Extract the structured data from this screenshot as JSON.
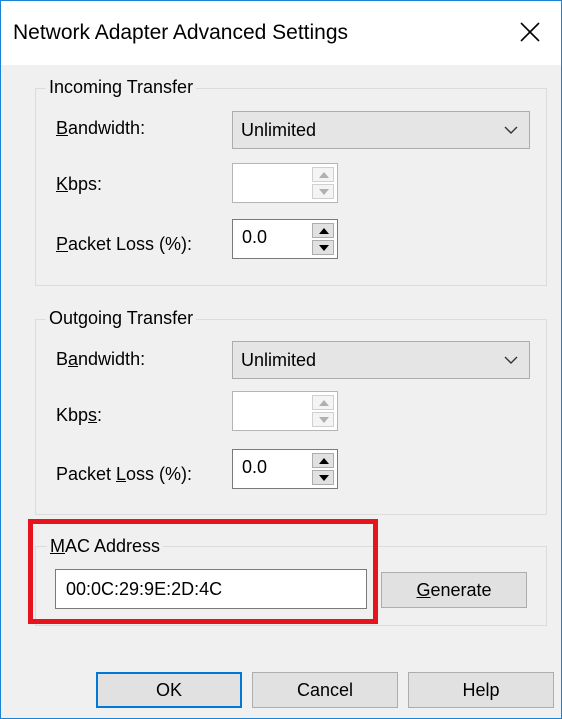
{
  "window": {
    "title": "Network Adapter Advanced Settings",
    "close_icon": "close-icon"
  },
  "incoming": {
    "legend": "Incoming Transfer",
    "bandwidth_label_pre": "",
    "bandwidth_label_mn": "B",
    "bandwidth_label_post": "andwidth:",
    "bandwidth_value": "Unlimited",
    "kbps_label_pre": "",
    "kbps_label_mn": "K",
    "kbps_label_post": "bps:",
    "kbps_value": "",
    "loss_label_pre": "",
    "loss_label_mn": "P",
    "loss_label_post": "acket Loss (%):",
    "loss_value": "0.0"
  },
  "outgoing": {
    "legend": "Outgoing Transfer",
    "bandwidth_label_pre": "B",
    "bandwidth_label_mn": "a",
    "bandwidth_label_post": "ndwidth:",
    "bandwidth_value": "Unlimited",
    "kbps_label_pre": "Kbp",
    "kbps_label_mn": "s",
    "kbps_label_post": ":",
    "kbps_value": "",
    "loss_label_pre": "Packet ",
    "loss_label_mn": "L",
    "loss_label_post": "oss (%):",
    "loss_value": "0.0"
  },
  "mac": {
    "legend_pre": "",
    "legend_mn": "M",
    "legend_post": "AC Address",
    "value": "00:0C:29:9E:2D:4C",
    "generate_pre": "",
    "generate_mn": "G",
    "generate_post": "enerate"
  },
  "footer": {
    "ok_label": "OK",
    "cancel_label": "Cancel",
    "help_label": "Help"
  },
  "colors": {
    "highlight": "#e6141e",
    "window_border": "#1883d7",
    "default_button_border": "#0078d7"
  }
}
